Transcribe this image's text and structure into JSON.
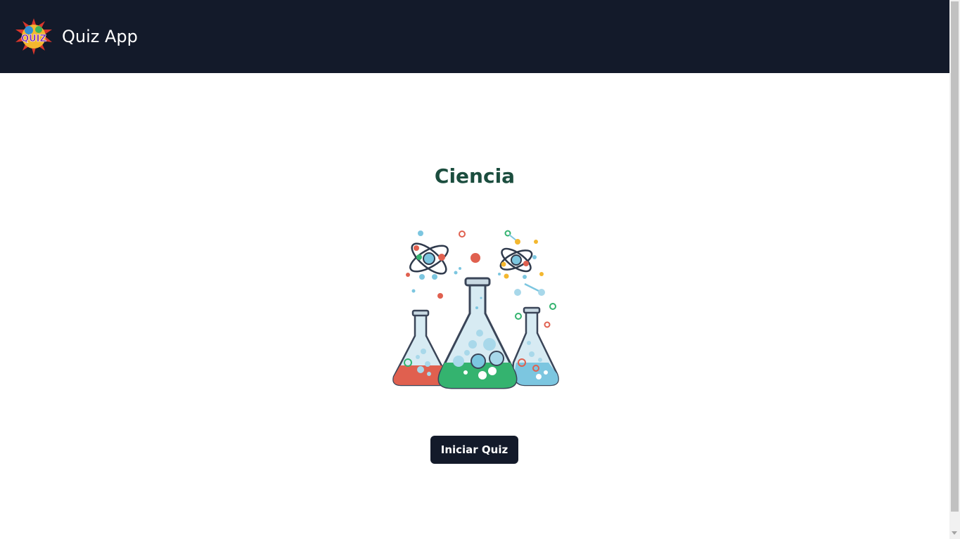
{
  "header": {
    "app_title": "Quiz App",
    "logo_icon": "quiz-logo-icon"
  },
  "main": {
    "category_title": "Ciencia",
    "illustration_icon": "science-flasks-icon",
    "start_button_label": "Iniciar Quiz"
  },
  "colors": {
    "navbar_bg": "#131a2a",
    "title_color": "#1b4d3e",
    "button_bg": "#131a2a",
    "button_text": "#ffffff",
    "flask_red": "#e0604f",
    "flask_green": "#34b36f",
    "flask_blue": "#7cc6e0"
  }
}
